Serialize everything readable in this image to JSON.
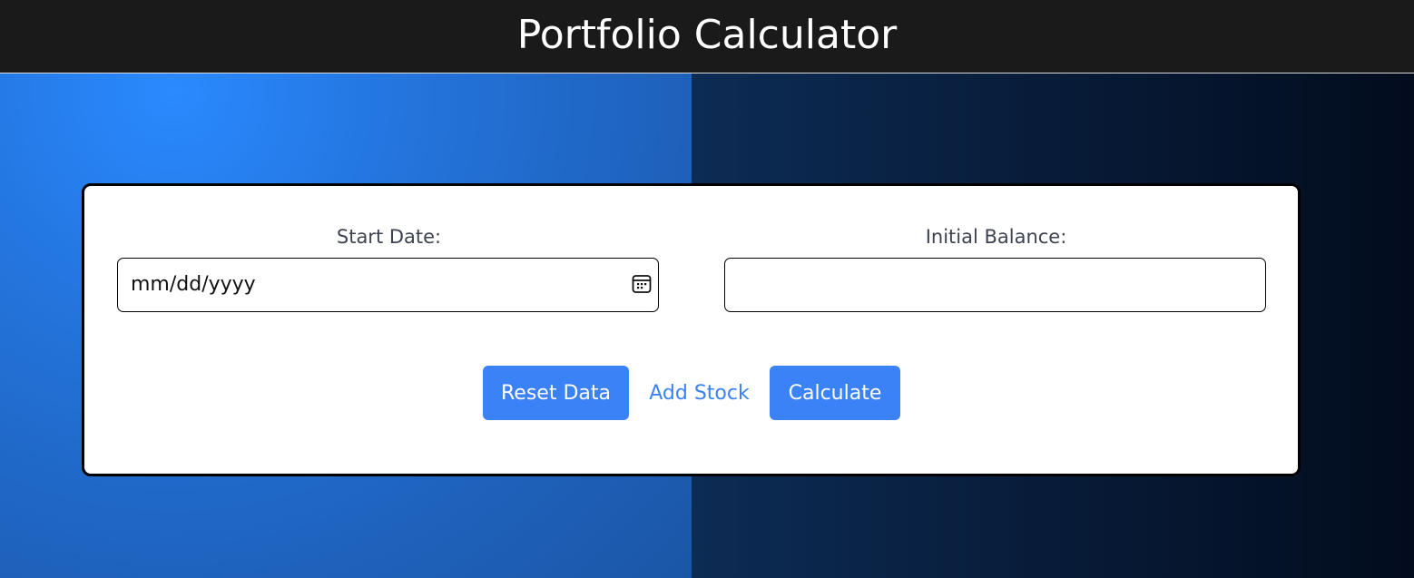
{
  "header": {
    "title": "Portfolio Calculator"
  },
  "form": {
    "start_date": {
      "label": "Start Date:",
      "placeholder": "mm/dd/yyyy",
      "icon": "calendar-icon"
    },
    "initial_balance": {
      "label": "Initial Balance:",
      "value": ""
    }
  },
  "actions": {
    "reset_label": "Reset Data",
    "add_stock_label": "Add Stock",
    "calculate_label": "Calculate"
  },
  "colors": {
    "header_bg": "#1b1a1a",
    "accent": "#3b82f6",
    "left_bg": "#2476e0",
    "right_bg": "#081d3b",
    "card_bg": "#ffffff"
  }
}
